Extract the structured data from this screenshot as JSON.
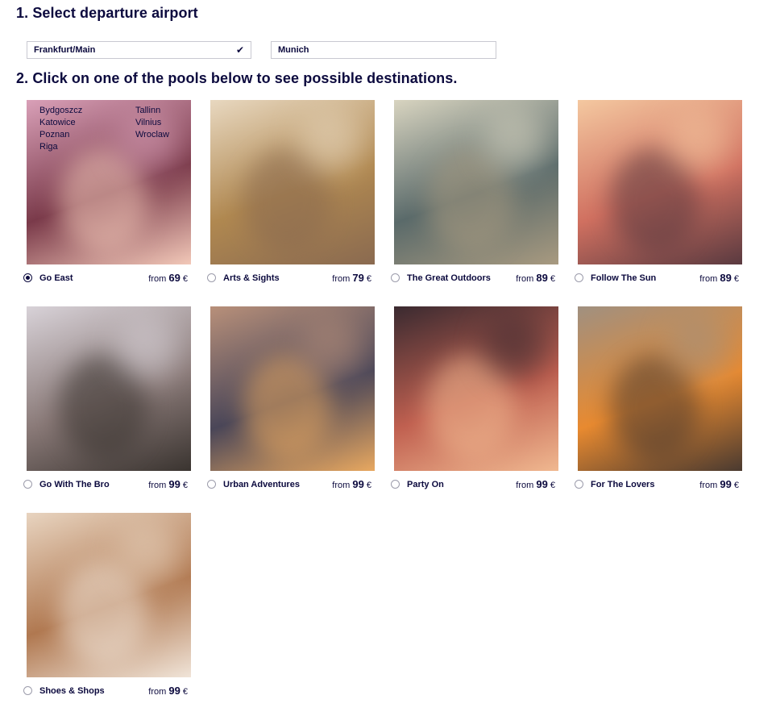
{
  "step1": {
    "title": "1. Select departure airport"
  },
  "airports": [
    {
      "name": "Frankfurt/Main",
      "selected": true
    },
    {
      "name": "Munich",
      "selected": false
    }
  ],
  "step2": {
    "title": "2. Click on one of the pools below to see possible destinations."
  },
  "price_prefix": "from",
  "currency": "€",
  "pools": [
    {
      "name": "Go East",
      "price": "69",
      "selected": true,
      "destinations": [
        "Bydgoszcz",
        "Tallinn",
        "Katowice",
        "Vilnius",
        "Poznan",
        "Wroclaw",
        "Riga"
      ],
      "colors": [
        "#d9a0b8",
        "#7a3a4a",
        "#f2c8b8"
      ]
    },
    {
      "name": "Arts & Sights",
      "price": "79",
      "selected": false,
      "colors": [
        "#e8d8c0",
        "#b08850",
        "#8a6a50"
      ]
    },
    {
      "name": "The Great Outdoors",
      "price": "89",
      "selected": false,
      "colors": [
        "#d8d4c0",
        "#5a6a6a",
        "#a89a80"
      ]
    },
    {
      "name": "Follow The Sun",
      "price": "89",
      "selected": false,
      "colors": [
        "#f4c8a0",
        "#d07060",
        "#5a3a40"
      ]
    },
    {
      "name": "Go With The Bro",
      "price": "99",
      "selected": false,
      "colors": [
        "#d8d2d8",
        "#8a7a78",
        "#3a3430"
      ]
    },
    {
      "name": "Urban Adventures",
      "price": "99",
      "selected": false,
      "colors": [
        "#b8907a",
        "#4a4658",
        "#e8a860"
      ]
    },
    {
      "name": "Party On",
      "price": "99",
      "selected": false,
      "colors": [
        "#3a2a30",
        "#c06050",
        "#f0b890"
      ]
    },
    {
      "name": "For The Lovers",
      "price": "99",
      "selected": false,
      "colors": [
        "#a09080",
        "#e88a30",
        "#4a3a30"
      ]
    },
    {
      "name": "Shoes & Shops",
      "price": "99",
      "selected": false,
      "colors": [
        "#e8d4c0",
        "#b07850",
        "#f0e4d8"
      ]
    }
  ]
}
